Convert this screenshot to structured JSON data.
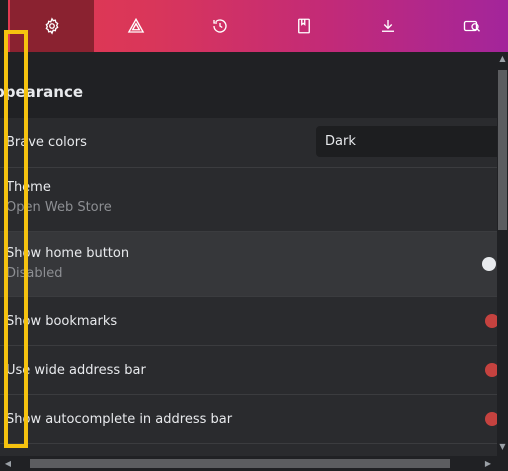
{
  "tabs": [
    {
      "name": "settings-tab",
      "icon": "gear-icon",
      "active": true
    },
    {
      "name": "shields-tab",
      "icon": "triangle-icon",
      "active": false
    },
    {
      "name": "history-tab",
      "icon": "history-icon",
      "active": false
    },
    {
      "name": "bookmarks-tab",
      "icon": "bookmark-icon",
      "active": false
    },
    {
      "name": "downloads-tab",
      "icon": "download-icon",
      "active": false
    },
    {
      "name": "wallet-tab",
      "icon": "wallet-search-icon",
      "active": false
    }
  ],
  "section": {
    "title": "ppearance"
  },
  "settings": {
    "brave_colors": {
      "label": "Brave colors",
      "value": "Dark"
    },
    "theme": {
      "label": "Theme",
      "sublabel": "Open Web Store"
    },
    "home_button": {
      "label": "Show home button",
      "sublabel": "Disabled",
      "on": false
    },
    "bookmarks": {
      "label": "Show bookmarks",
      "on": true
    },
    "wide_bar": {
      "label": "Use wide address bar",
      "on": true
    },
    "autocomplete": {
      "label": "Show autocomplete in address bar",
      "on": true
    }
  },
  "colors": {
    "toggle_on": "#c5423f",
    "toggle_off": "#e8eaed",
    "annotation": "#f5c20f"
  }
}
